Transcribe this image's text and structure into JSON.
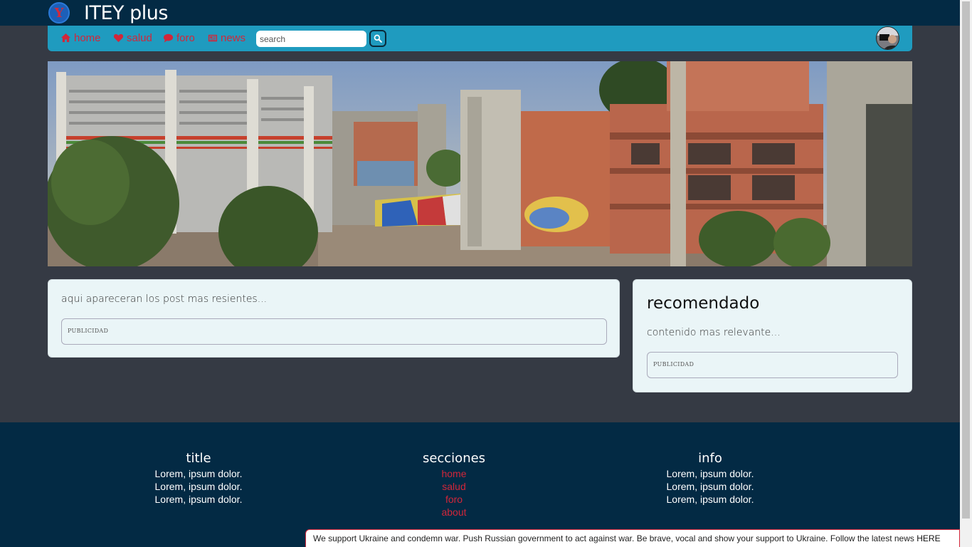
{
  "header": {
    "logo_glyph": "Y",
    "title": "ITEY plus"
  },
  "nav": {
    "items": [
      {
        "label": "home",
        "icon": "home-icon"
      },
      {
        "label": "salud",
        "icon": "heart-icon"
      },
      {
        "label": "foro",
        "icon": "comment-icon"
      },
      {
        "label": "news",
        "icon": "newspaper-icon"
      }
    ],
    "search_placeholder": "search"
  },
  "main": {
    "posts_text": "aqui apareceran los post mas resientes...",
    "ad_label": "PUBLICIDAD"
  },
  "sidebar": {
    "title": "recomendado",
    "text": "contenido mas relevante...",
    "ad_label": "PUBLICIDAD"
  },
  "footer": {
    "col1": {
      "title": "title",
      "lines": [
        "Lorem, ipsum dolor.",
        "Lorem, ipsum dolor.",
        "Lorem, ipsum dolor."
      ]
    },
    "col2": {
      "title": "secciones",
      "links": [
        "home",
        "salud",
        "foro",
        "about"
      ]
    },
    "col3": {
      "title": "info",
      "lines": [
        "Lorem, ipsum dolor.",
        "Lorem, ipsum dolor.",
        "Lorem, ipsum dolor."
      ]
    }
  },
  "banner": {
    "text": "We support Ukraine and condemn war. Push Russian government to act against war. Be brave, vocal and show your support to Ukraine. Follow the latest news ",
    "link": "HERE"
  },
  "colors": {
    "topbar": "#032a44",
    "nav": "#1f9bbf",
    "accent": "#d2263a",
    "page_bg": "#353a44",
    "card_bg": "#eaf5f7"
  }
}
